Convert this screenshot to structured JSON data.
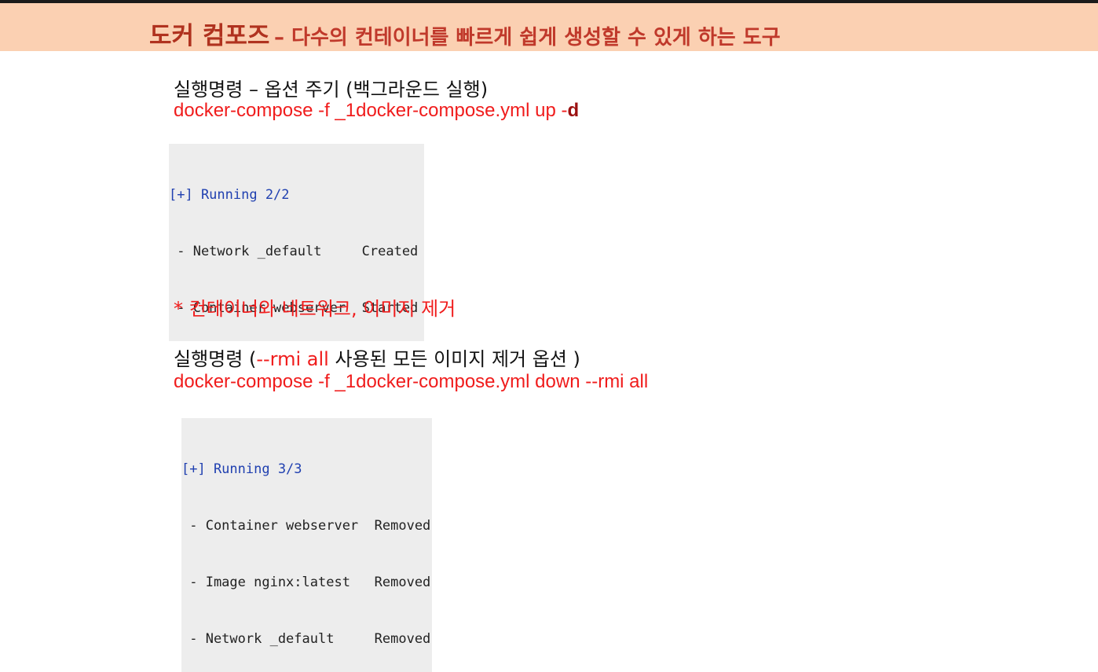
{
  "banner": {
    "title_main": "도커 컴포즈",
    "title_sub": "– 다수의 컨테이너를 빠르게 쉽게 생성할 수 있게 하는 도구"
  },
  "section1": {
    "heading": "실행명령 – 옵션 주기 (백그라운드 실행)",
    "command_prefix": "docker-compose -f _1docker-compose.yml up ",
    "command_flag_dash": "-",
    "command_flag_letter": "d",
    "terminal": {
      "header": "[+] Running 2/2",
      "rows": [
        {
          "name": " - Network _default     ",
          "status": "Created"
        },
        {
          "name": " - Container webserver  ",
          "status": "Started"
        }
      ]
    }
  },
  "section2": {
    "note": "* 컨테이너와 네트워크, 이미지 제거",
    "heading_label": "실행명령  ",
    "heading_open": "(",
    "heading_red": "--rmi all",
    "heading_rest": "  사용된 모든 이미지 제거 옵션 )",
    "command": "docker-compose -f _1docker-compose.yml down --rmi all",
    "terminal": {
      "header": "[+] Running 3/3",
      "rows": [
        {
          "name": " - Container webserver  ",
          "status": "Removed"
        },
        {
          "name": " - Image nginx:latest   ",
          "status": "Removed"
        },
        {
          "name": " - Network _default     ",
          "status": "Removed"
        }
      ]
    }
  },
  "colors": {
    "banner_bg": "#fbd0b2",
    "title_red": "#c0392b",
    "command_red": "#f01c1c",
    "flag_darkred": "#9b1010",
    "terminal_bg": "#ededed",
    "terminal_header_blue": "#2040b0"
  }
}
